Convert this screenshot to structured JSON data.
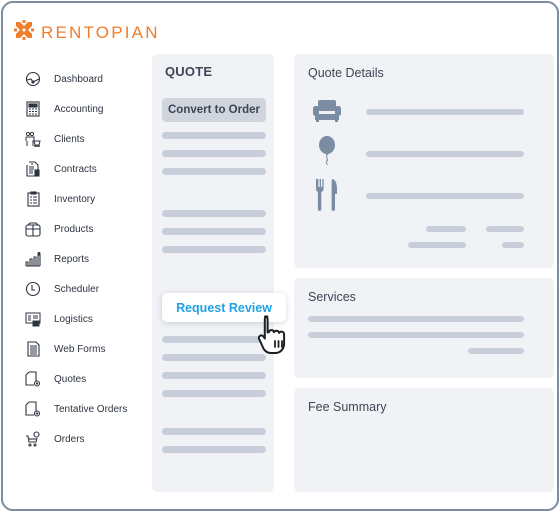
{
  "brand": {
    "name": "RENTOPIAN",
    "color": "#ef7d2c",
    "logo_icon": "rentopian-x-logo-icon"
  },
  "sidebar": {
    "items": [
      {
        "label": "Dashboard",
        "icon": "dashboard-gauge-icon"
      },
      {
        "label": "Accounting",
        "icon": "calculator-icon"
      },
      {
        "label": "Clients",
        "icon": "clients-icon"
      },
      {
        "label": "Contracts",
        "icon": "contract-document-icon"
      },
      {
        "label": "Inventory",
        "icon": "clipboard-list-icon"
      },
      {
        "label": "Products",
        "icon": "box-icon"
      },
      {
        "label": "Reports",
        "icon": "bar-chart-icon"
      },
      {
        "label": "Scheduler",
        "icon": "clock-icon"
      },
      {
        "label": "Logistics",
        "icon": "logistics-map-icon"
      },
      {
        "label": "Web Forms",
        "icon": "web-form-icon"
      },
      {
        "label": "Quotes",
        "icon": "quote-document-icon"
      },
      {
        "label": "Tentative Orders",
        "icon": "tentative-order-icon"
      },
      {
        "label": "Orders",
        "icon": "shopping-cart-icon"
      }
    ]
  },
  "quote_panel": {
    "title": "QUOTE",
    "convert_button": "Convert to Order",
    "request_review_button": "Request Review",
    "request_review_color": "#1fa2e6"
  },
  "quote_details": {
    "title": "Quote Details",
    "rows": [
      {
        "icon": "armchair-icon"
      },
      {
        "icon": "balloon-icon"
      },
      {
        "icon": "fork-knife-icon"
      }
    ]
  },
  "services": {
    "title": "Services"
  },
  "fee_summary": {
    "title": "Fee Summary"
  },
  "colors": {
    "frame_border": "#7d8ca0",
    "panel_bg": "#f0f2f6",
    "placeholder_bar": "#c8ced9",
    "icon_gray": "#7b8ca3"
  }
}
